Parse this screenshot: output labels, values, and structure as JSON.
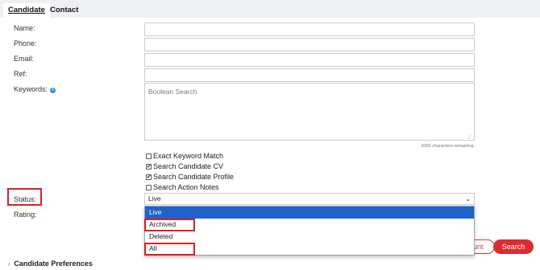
{
  "tabs": [
    {
      "label": "Candidate"
    },
    {
      "label": "Contact"
    }
  ],
  "form": {
    "name_label": "Name:",
    "phone_label": "Phone:",
    "email_label": "Email:",
    "ref_label": "Ref:",
    "keywords_label": "Keywords:",
    "keywords_placeholder": "Boolean Search",
    "chars_remaining": "2000 characters remaining.",
    "checkboxes": [
      {
        "label": "Exact Keyword Match",
        "checked": false
      },
      {
        "label": "Search Candidate CV",
        "checked": true
      },
      {
        "label": "Search Candidate Profile",
        "checked": true
      },
      {
        "label": "Search Action Notes",
        "checked": false
      }
    ],
    "status_label": "Status:",
    "status_value": "Live",
    "rating_label": "Rating:"
  },
  "dropdown": {
    "options": [
      "Live",
      "Archived",
      "Deleted",
      "All"
    ],
    "selected": "Live"
  },
  "buttons": {
    "count": "ount",
    "search": "Search"
  },
  "sections": {
    "candidate_preferences": "Candidate Preferences"
  },
  "colors": {
    "accent_red": "#dd2c2f",
    "dropdown_selected": "#1e63cc",
    "highlight_red": "#d8211f",
    "info_blue": "#3b8ee5"
  }
}
